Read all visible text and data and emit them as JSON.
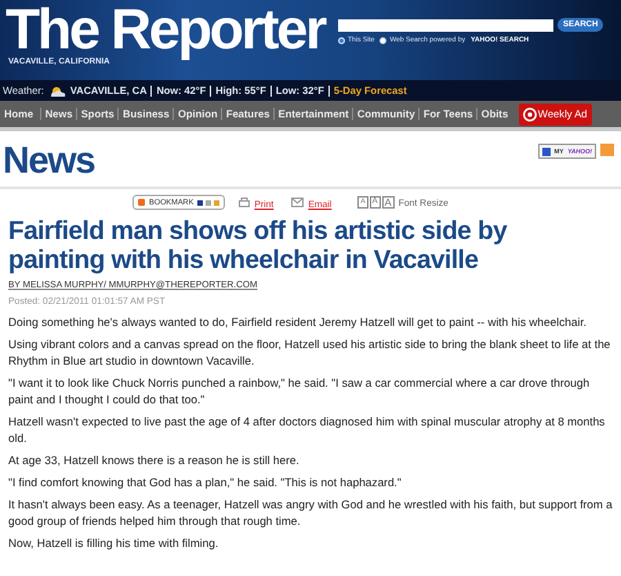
{
  "header": {
    "title": "The Reporter",
    "location": "VACAVILLE, CALIFORNIA",
    "search": {
      "button": "SEARCH",
      "options": [
        {
          "label": "This Site",
          "selected": true
        },
        {
          "label": "Web Search powered by",
          "selected": false
        }
      ],
      "brand": "YAHOO! SEARCH"
    }
  },
  "weather": {
    "label": "Weather:",
    "location": "VACAVILLE, CA",
    "readings": [
      "Now: 42°F",
      "High: 55°F",
      "Low: 32°F"
    ],
    "forecast": "5-Day Forecast"
  },
  "nav": {
    "items": [
      "Home",
      "News",
      "Sports",
      "Business",
      "Opinion",
      "Features",
      "Entertainment",
      "Community",
      "For Teens",
      "Obits"
    ],
    "ad": "Weekly Ad"
  },
  "section": {
    "title": "News",
    "my_yahoo": {
      "prefix": "MY",
      "brand": "YAHOO!"
    }
  },
  "toolbar": {
    "bookmark": "BOOKMARK",
    "print": "Print",
    "email": "Email",
    "font_keys": [
      "A",
      "A",
      "A"
    ],
    "font_resize": "Font Resize"
  },
  "article": {
    "headline": "Fairfield man shows off his artistic side by painting with his wheelchair in Vacaville",
    "byline": "BY MELISSA MURPHY/ MMURPHY@THEREPORTER.COM",
    "posted": "Posted:  02/21/2011 01:01:57 AM PST",
    "paragraphs": [
      "Doing something he's always wanted to do, Fairfield resident Jeremy Hatzell will get to paint -- with his wheelchair.",
      "Using vibrant colors and a canvas spread on the floor, Hatzell used his artistic side to bring the blank sheet to life at the Rhythm in Blue art studio in downtown Vacaville.",
      "\"I want it to look like Chuck Norris punched a rainbow,\" he said. \"I saw a car commercial where a car drove through paint and I thought I could do that too.\"",
      "Hatzell wasn't expected to live past the age of 4 after doctors diagnosed him with spinal muscular atrophy at 8 months old.",
      "At age 33, Hatzell knows there is a reason he is still here.",
      "\"I find comfort knowing that God has a plan,\" he said. \"This is not haphazard.\"",
      "It hasn't always been easy. As a teenager, Hatzell was angry with God and he wrestled with his faith, but support from a good group of friends helped him through that rough time.",
      "Now, Hatzell is filling his time with filming."
    ]
  }
}
